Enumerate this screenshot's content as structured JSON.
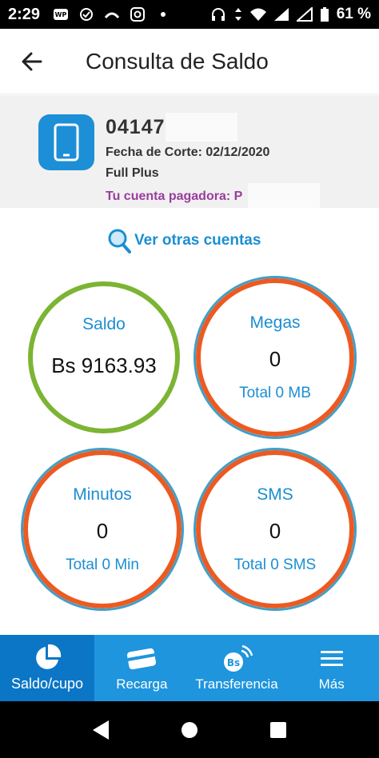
{
  "status_bar": {
    "time": "2:29",
    "battery": "61 %",
    "icons_left": [
      "whatsapp-icon",
      "signal-app-icon",
      "missed-call-icon",
      "instagram-icon",
      "dot-icon"
    ],
    "icons_right": [
      "headphones-icon",
      "data-arrows-icon",
      "wifi-icon",
      "cell-signal-icon",
      "cell-signal-icon",
      "battery-icon"
    ]
  },
  "appbar": {
    "back_icon": "arrow-left-icon",
    "title": "Consulta de Saldo"
  },
  "account": {
    "icon": "phone-icon",
    "number": "04147",
    "fecha_corte": "Fecha de Corte: 02/12/2020",
    "plan": "Full Plus",
    "pagadora": "Tu cuenta pagadora: P"
  },
  "ver_otras": {
    "icon": "search-icon",
    "label": "Ver otras cuentas"
  },
  "balances": {
    "saldo": {
      "label": "Saldo",
      "value": "Bs 9163.93"
    },
    "megas": {
      "label": "Megas",
      "value": "0",
      "total": "Total 0 MB"
    },
    "minutos": {
      "label": "Minutos",
      "value": "0",
      "total": "Total 0 Min"
    },
    "sms": {
      "label": "SMS",
      "value": "0",
      "total": "Total 0 SMS"
    }
  },
  "colors": {
    "accent_blue": "#1e95dd",
    "active_blue": "#0b76c6",
    "green_ring": "#7cb433",
    "orange_ring": "#ec5a22",
    "purple_text": "#9b3c9e"
  },
  "bottom_nav": [
    {
      "label": "Saldo/cupo",
      "icon": "pie-chart-icon",
      "active": true
    },
    {
      "label": "Recarga",
      "icon": "credit-card-icon",
      "active": false
    },
    {
      "label": "Transferencia",
      "icon": "bs-transfer-icon",
      "active": false
    },
    {
      "label": "Más",
      "icon": "menu-icon",
      "active": false
    }
  ],
  "system_nav": [
    "back-triangle-icon",
    "home-circle-icon",
    "recents-square-icon"
  ]
}
